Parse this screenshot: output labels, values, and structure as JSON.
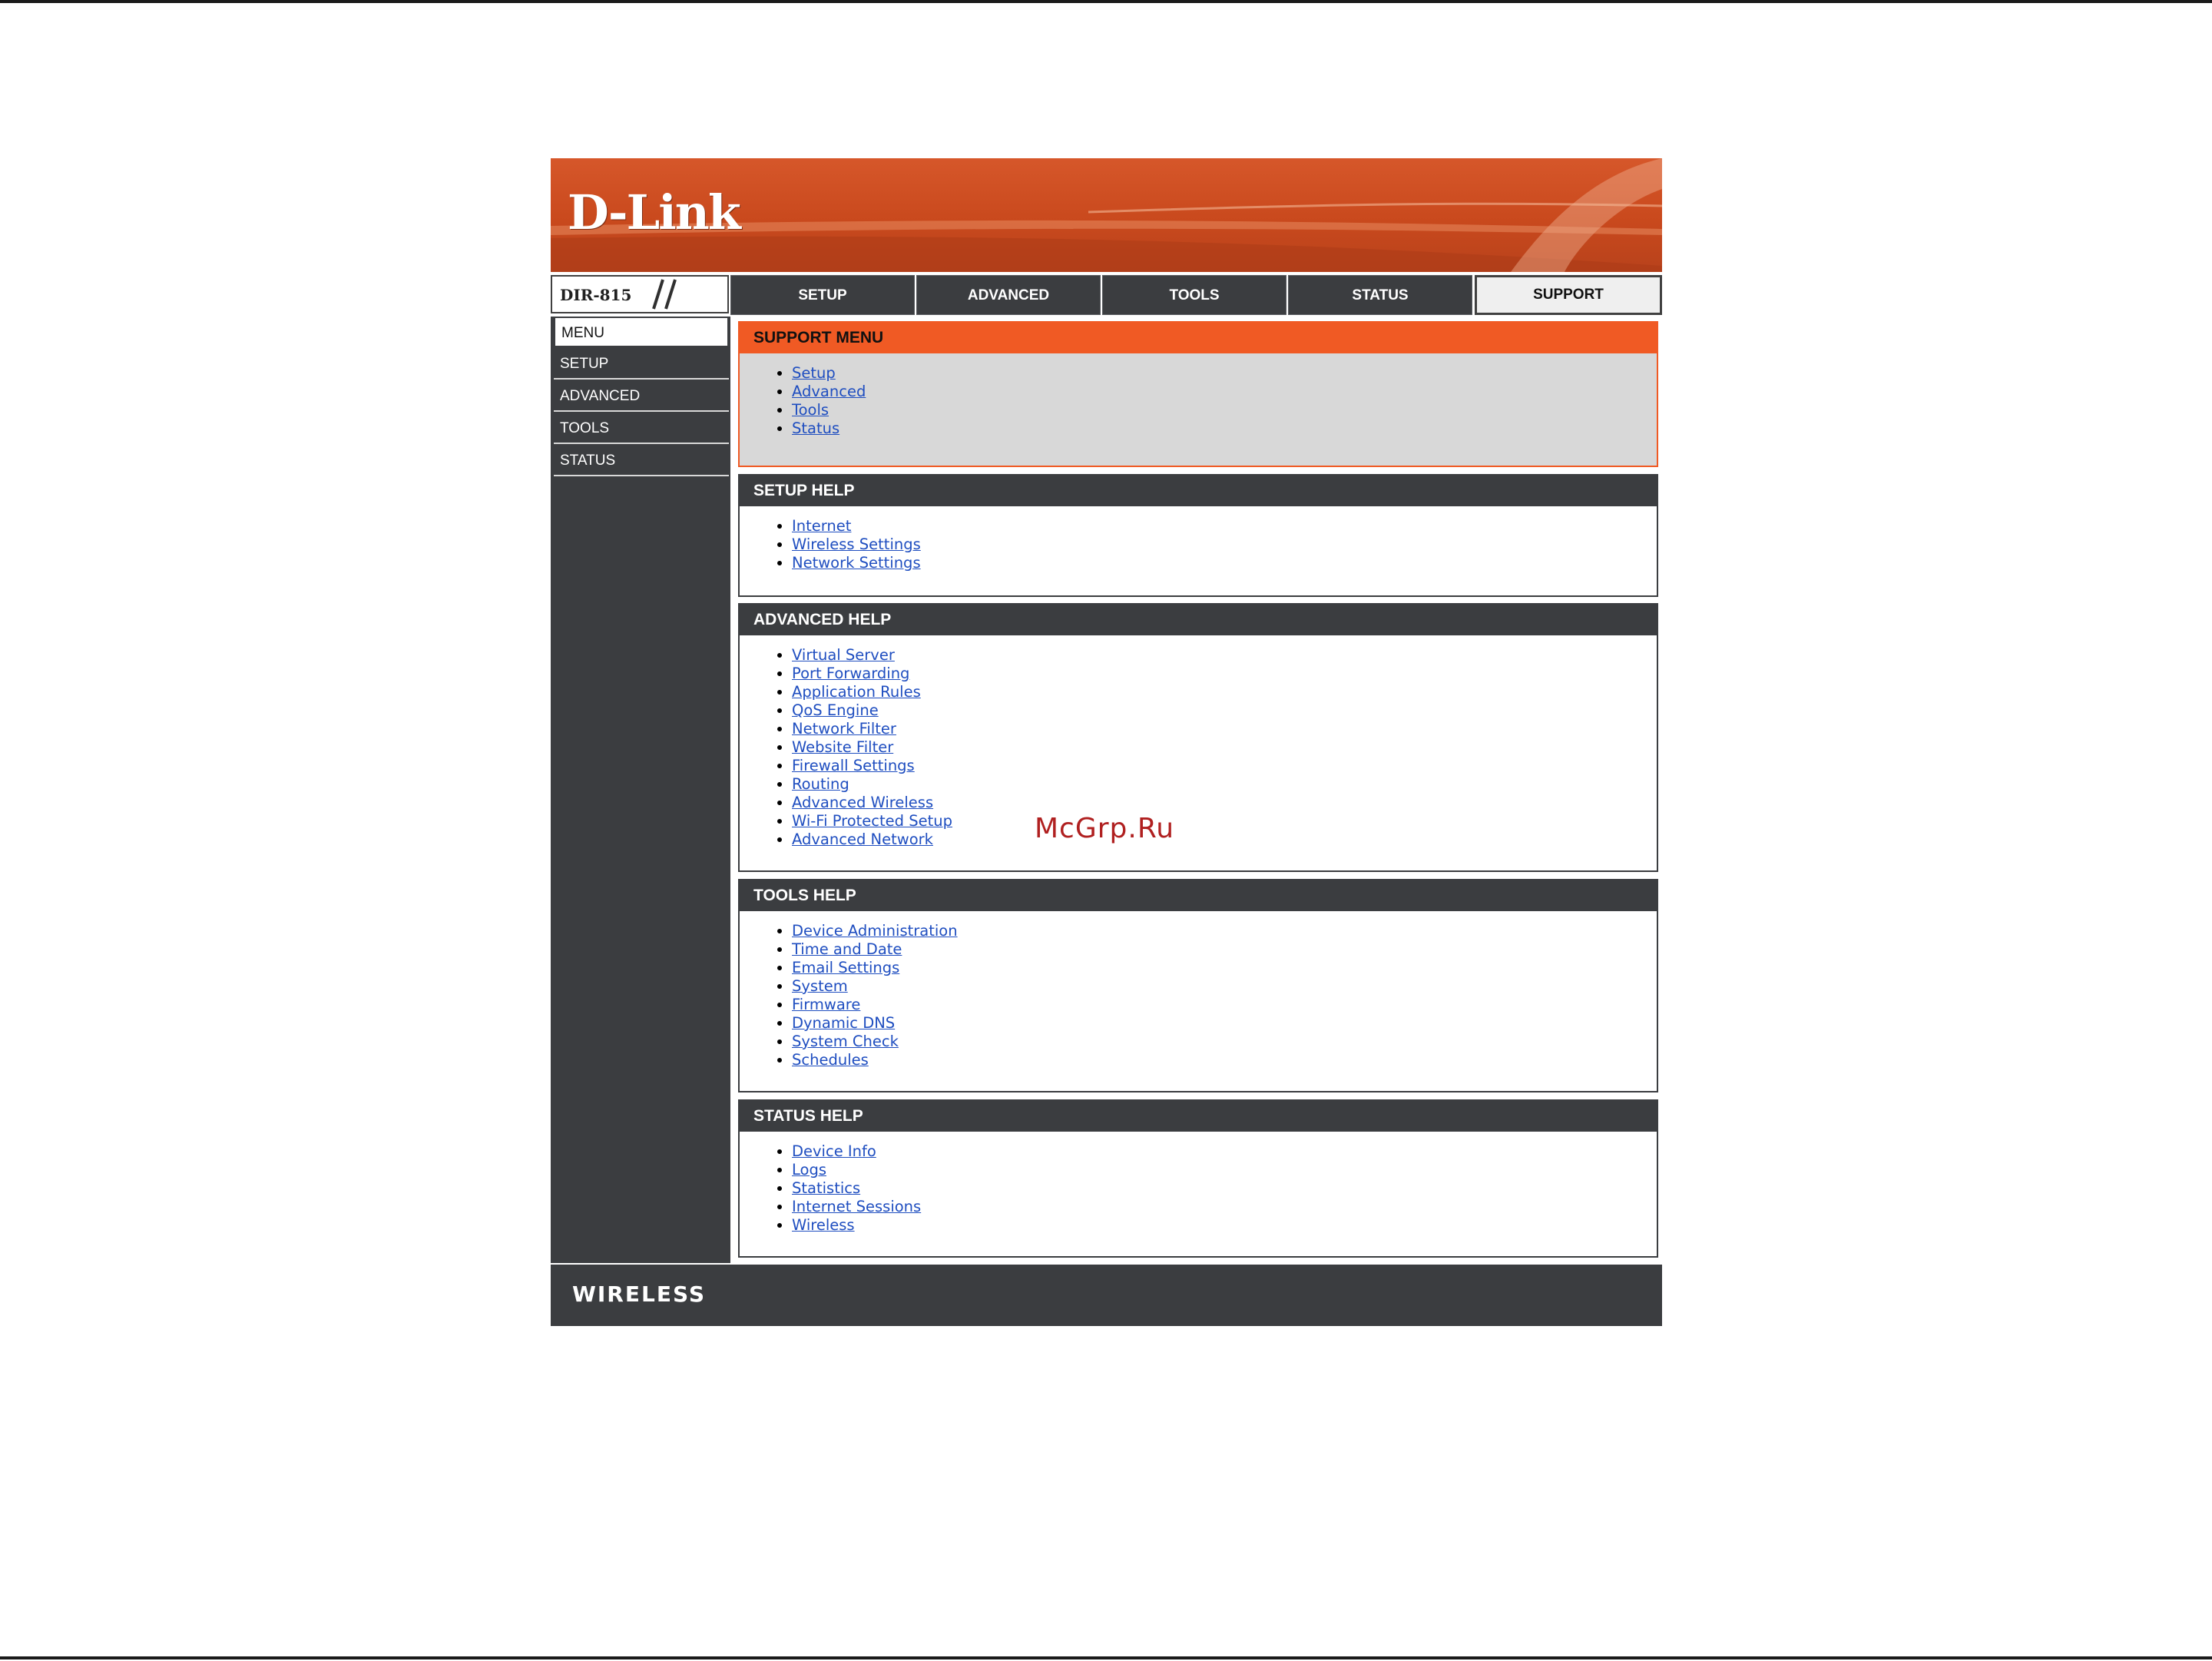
{
  "brand": {
    "logo_text": "D-Link",
    "model": "DIR-815",
    "footer": "WIRELESS"
  },
  "nav": {
    "tabs": [
      {
        "label": "SETUP"
      },
      {
        "label": "ADVANCED"
      },
      {
        "label": "TOOLS"
      },
      {
        "label": "STATUS"
      },
      {
        "label": "SUPPORT",
        "active": true
      }
    ]
  },
  "sidebar": {
    "items": [
      {
        "label": "MENU",
        "active": true
      },
      {
        "label": "SETUP"
      },
      {
        "label": "ADVANCED"
      },
      {
        "label": "TOOLS"
      },
      {
        "label": "STATUS"
      }
    ]
  },
  "panels": {
    "support_menu": {
      "title": "SUPPORT MENU",
      "links": [
        "Setup",
        "Advanced",
        "Tools",
        "Status"
      ]
    },
    "setup_help": {
      "title": "SETUP HELP",
      "links": [
        "Internet",
        "Wireless Settings",
        "Network Settings"
      ]
    },
    "advanced_help": {
      "title": "ADVANCED HELP",
      "links": [
        "Virtual Server",
        "Port Forwarding",
        "Application Rules",
        "QoS Engine",
        "Network Filter",
        "Website Filter",
        "Firewall Settings",
        "Routing",
        "Advanced Wireless",
        "Wi-Fi Protected Setup",
        "Advanced Network"
      ]
    },
    "tools_help": {
      "title": "TOOLS HELP",
      "links": [
        "Device Administration",
        "Time and Date",
        "Email Settings",
        "System",
        "Firmware",
        "Dynamic DNS",
        "System Check",
        "Schedules"
      ]
    },
    "status_help": {
      "title": "STATUS HELP",
      "links": [
        "Device Info",
        "Logs",
        "Statistics",
        "Internet Sessions",
        "Wireless"
      ]
    }
  },
  "watermark": "McGrp.Ru",
  "colors": {
    "accent": "#f05a24",
    "dark": "#3b3d40",
    "link": "#1f4ec0",
    "banner": "#c9491d"
  }
}
